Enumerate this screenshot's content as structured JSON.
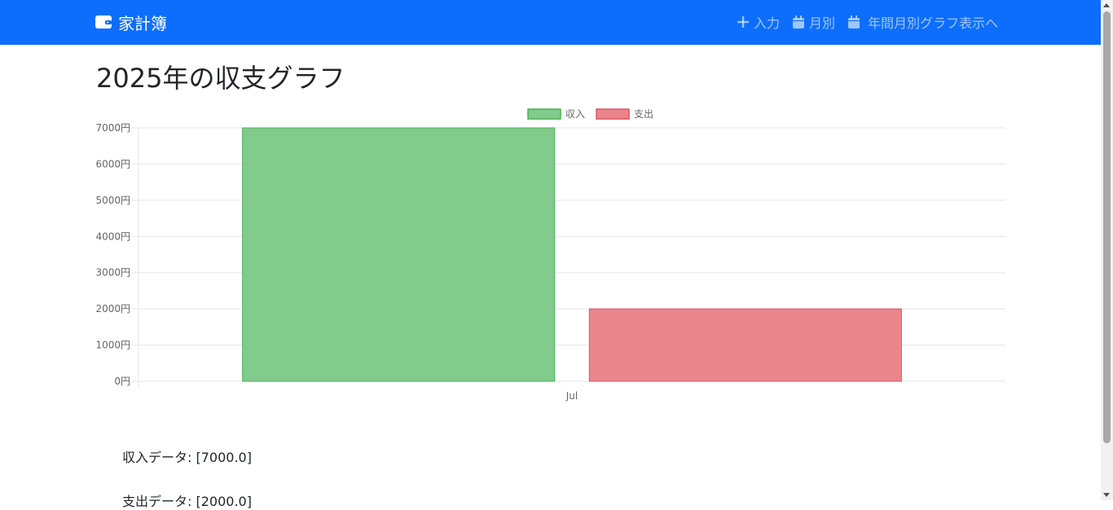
{
  "navbar": {
    "brand": "家計簿",
    "brand_icon": "wallet-icon",
    "items": [
      {
        "label": "入力",
        "icon": "plus-icon"
      },
      {
        "label": "月別",
        "icon": "calendar-icon"
      },
      {
        "label": "年間月別グラフ表示へ",
        "icon": "calendar-icon"
      }
    ],
    "bg_color": "#0d6efd"
  },
  "page": {
    "title": "2025年の収支グラフ"
  },
  "chart_data": {
    "type": "bar",
    "categories": [
      "Jul"
    ],
    "series": [
      {
        "name": "収入",
        "values": [
          7000
        ],
        "color": "#81cb8d",
        "border": "#4caf50"
      },
      {
        "name": "支出",
        "values": [
          2000
        ],
        "color": "#ea858e",
        "border": "#e05260"
      }
    ],
    "ylim": [
      0,
      7000
    ],
    "yticks": [
      0,
      1000,
      2000,
      3000,
      4000,
      5000,
      6000,
      7000
    ],
    "ytick_suffix": "円",
    "legend": "top-center",
    "grid": true
  },
  "data_text": {
    "income": "収入データ: [7000.0]",
    "expense": "支出データ: [2000.0]"
  }
}
